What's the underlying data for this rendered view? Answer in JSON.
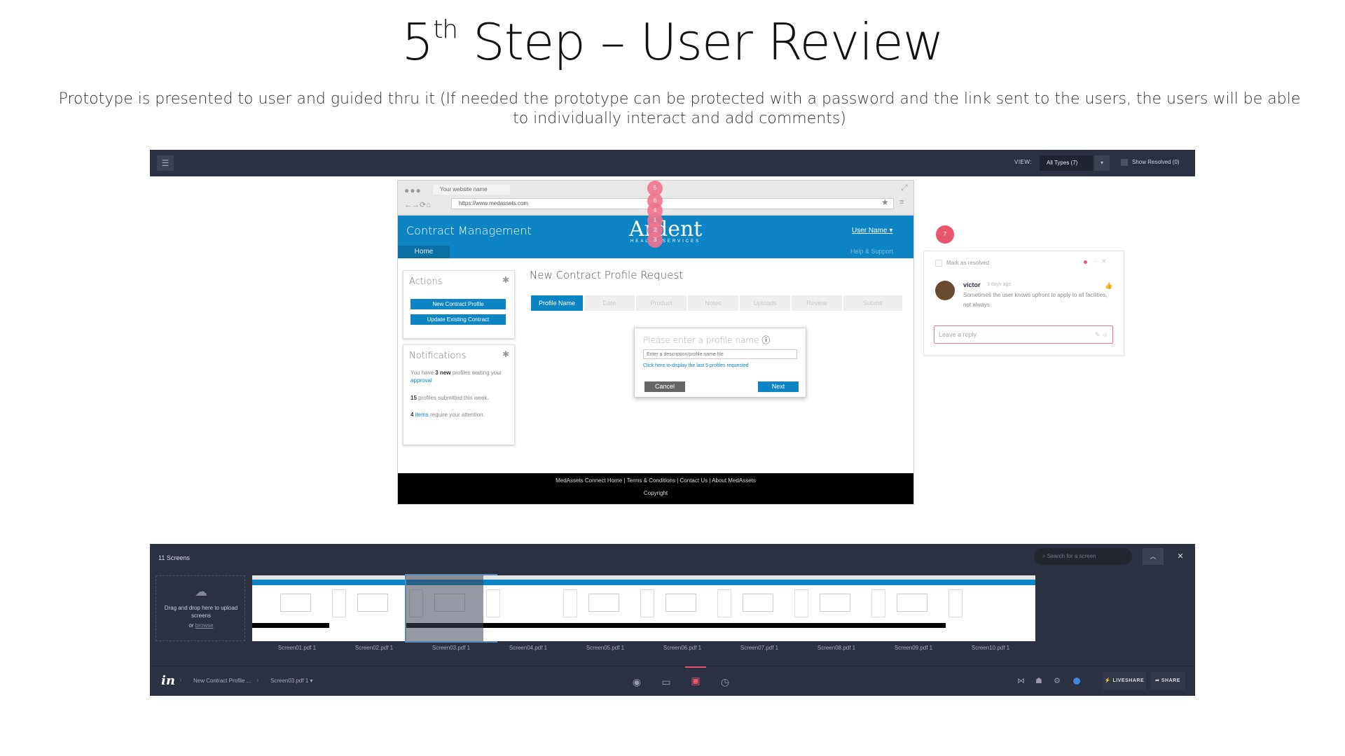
{
  "slide": {
    "title_main": "5",
    "title_sup": "th",
    "title_rest": " Step – User Review",
    "subtitle": "Prototype is presented to user and guided thru it (If needed the prototype can be protected with a password and the link sent to the users, the users will be able to individually interact and add comments)"
  },
  "top_bar": {
    "view_label": "VIEW:",
    "view_value": "All Types (7)",
    "show_resolved": "Show Resolved (0)"
  },
  "browser": {
    "tab_title": "Your website name",
    "url": "https://www.medassets.com"
  },
  "app": {
    "title": "Contract Management",
    "logo": "Ardent",
    "logo_sub": "HEALTH SERVICES",
    "user_name": "User Name ▾",
    "nav_home": "Home",
    "nav_help": "Help & Support",
    "actions_title": "Actions",
    "btn_new": "New Contract Profile",
    "btn_update": "Update Existing Contract",
    "notif_title": "Notifications",
    "notif_1_pre": "You have ",
    "notif_1_bold": "3 new",
    "notif_1_mid": " profiles waiting your ",
    "notif_1_link": "approval",
    "notif_2_bold": "15",
    "notif_2_rest": " profiles submitted this week.",
    "notif_3_bold": "4",
    "notif_3_link": " items",
    "notif_3_rest": " require your attention.",
    "request_title": "New Contract Profile Request",
    "steps": [
      "Profile Name",
      "Date",
      "Product",
      "Notes",
      "Uploads",
      "Review",
      "Submit"
    ],
    "dialog_title": "Please enter a profile name",
    "dialog_placeholder": "Enter a description/profile name file",
    "dialog_link": "Click here to display the last 5 profiles requested",
    "dialog_cancel": "Cancel",
    "dialog_next": "Next",
    "footer_links": "MedAssets Connect Home  |  Terms & Conditions  |  Contact Us  |  About MedAssets",
    "footer_copy": "Copyright"
  },
  "pins": [
    "5",
    "6",
    "4",
    "1",
    "2",
    "3"
  ],
  "comment": {
    "pin": "7",
    "mark_resolved": "Mark as resolved",
    "author": "victor",
    "time": "3 days ago",
    "text": "Sometimes the user knows upfront to apply to all facilities, not always",
    "reply_placeholder": "Leave a reply"
  },
  "screens": {
    "count": "11 Screens",
    "search_placeholder": "Search for a screen",
    "upload_text": "Drag and drop here to upload screens",
    "upload_or": "or ",
    "upload_browse": "browse",
    "labels": [
      "Screen01.pdf 1",
      "Screen02.pdf 1",
      "Screen03.pdf 1",
      "Screen04.pdf 1",
      "Screen05.pdf 1",
      "Screen06.pdf 1",
      "Screen07.pdf 1",
      "Screen08.pdf 1",
      "Screen09.pdf 1",
      "Screen10.pdf 1"
    ]
  },
  "bottom_bar": {
    "crumb_project": "New Contract Profile ...",
    "crumb_screen": "Screen03.pdf 1",
    "liveshare": "LIVESHARE",
    "share": "SHARE"
  },
  "colors": {
    "brand_blue": "#0d84c4",
    "invision_dark": "#2b3140",
    "comment_pink": "#e9546f"
  }
}
